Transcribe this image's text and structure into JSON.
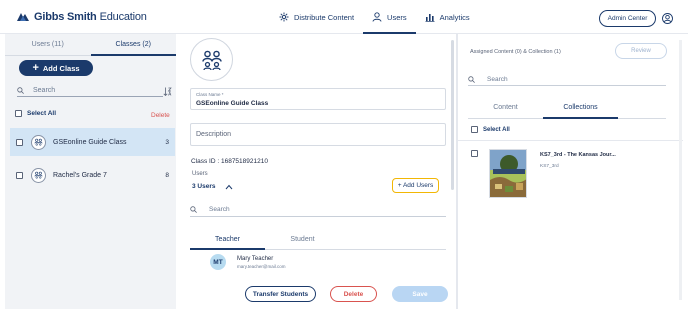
{
  "header": {
    "brand_bold": "Gibbs Smith",
    "brand_rest": "Education",
    "nav": [
      {
        "label": "Distribute Content",
        "icon": "distribute-icon"
      },
      {
        "label": "Users",
        "icon": "user-icon"
      },
      {
        "label": "Analytics",
        "icon": "bar-chart-icon"
      }
    ],
    "admin_center": "Admin Center"
  },
  "left_panel": {
    "tabs": [
      {
        "label": "Users (11)"
      },
      {
        "label": "Classes (2)"
      }
    ],
    "add_class": "Add Class",
    "search_placeholder": "Search",
    "select_all": "Select All",
    "delete": "Delete",
    "classes": [
      {
        "name": "GSEonline Guide Class",
        "count": "3",
        "selected": true
      },
      {
        "name": "Rachel's Grade 7",
        "count": "8",
        "selected": false
      }
    ]
  },
  "class_detail": {
    "class_name_label": "Class Name *",
    "class_name_value": "GSEonline Guide Class",
    "description_placeholder": "Description",
    "class_id_text": "Class ID : 1687518921210",
    "users_label": "Users",
    "users_count": "3 Users",
    "add_users": "+ Add Users",
    "search_placeholder": "Search",
    "tabs": [
      {
        "label": "Teacher"
      },
      {
        "label": "Student"
      }
    ],
    "members": [
      {
        "initials": "MT",
        "name": "Mary Teacher",
        "email": "mary.teacher@mail.com"
      }
    ],
    "transfer_students": "Transfer Students",
    "delete": "Delete",
    "save": "Save"
  },
  "assigned_panel": {
    "assigned_text": "Assigned Content (0) & Collection (1)",
    "review": "Review",
    "search_placeholder": "Search",
    "tabs": [
      {
        "label": "Content"
      },
      {
        "label": "Collections"
      }
    ],
    "select_all": "Select All",
    "collections": [
      {
        "title": "KS7_3rd - The Kansas Jour...",
        "subtitle": "KS7_3rd"
      }
    ]
  },
  "colors": {
    "brand_navy": "#1b3a6b",
    "selected_row": "#d3e5f5",
    "delete_red": "#d9534f",
    "highlight_outline": "#f2b705",
    "save_disabled": "#b9d6f3"
  }
}
